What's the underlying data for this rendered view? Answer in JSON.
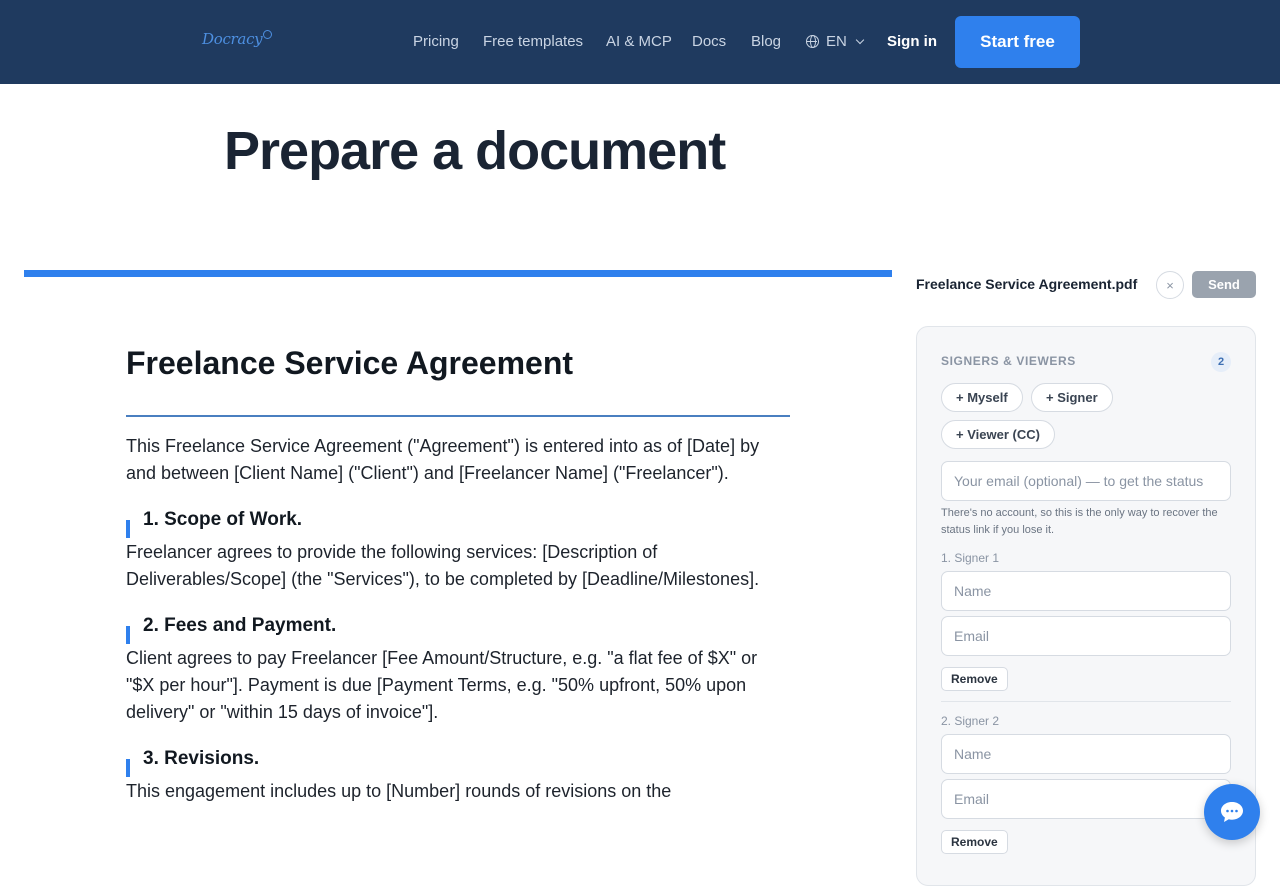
{
  "header": {
    "logo_text": "Docracy",
    "nav": [
      "Pricing",
      "Free templates",
      "AI & MCP",
      "Docs",
      "Blog"
    ],
    "language": "EN",
    "sign_in": "Sign in",
    "start_free": "Start free"
  },
  "page": {
    "title": "Prepare a document"
  },
  "document": {
    "title": "Freelance Service Agreement",
    "intro": "This Freelance Service Agreement (\"Agreement\") is entered into as of [Date] by and between [Client Name] (\"Client\") and [Freelancer Name] (\"Freelancer\").",
    "sections": [
      {
        "heading": "1. Scope of Work.",
        "body": "Freelancer agrees to provide the following services: [Description of Deliverables/Scope] (the \"Services\"), to be completed by [Deadline/Milestones]."
      },
      {
        "heading": "2. Fees and Payment.",
        "body": "Client agrees to pay Freelancer [Fee Amount/Structure, e.g. \"a flat fee of $X\" or \"$X per hour\"]. Payment is due [Payment Terms, e.g. \"50% upfront, 50% upon delivery\" or \"within 15 days of invoice\"]."
      },
      {
        "heading": "3. Revisions.",
        "body": "This engagement includes up to [Number] rounds of revisions on the"
      }
    ]
  },
  "panel": {
    "file_name": "Freelance Service Agreement.pdf",
    "close_symbol": "×",
    "send": "Send",
    "heading": "SIGNERS & VIEWERS",
    "count": "2",
    "add_buttons": [
      "+ Myself",
      "+ Signer",
      "+ Viewer (CC)"
    ],
    "email_placeholder": "Your email (optional) — to get the status",
    "hint": "There's no account, so this is the only way to recover the status link if you lose it.",
    "signers": [
      {
        "label": "1. Signer 1",
        "name_placeholder": "Name",
        "email_placeholder": "Email",
        "remove": "Remove"
      },
      {
        "label": "2. Signer 2",
        "name_placeholder": "Name",
        "email_placeholder": "Email",
        "remove": "Remove"
      }
    ]
  },
  "icons": {
    "globe": "globe-icon",
    "chevron": "chevron-down-icon",
    "chat": "chat-bubble-icon"
  },
  "colors": {
    "header_bg": "#1f3a5f",
    "accent": "#2f80ed",
    "send_disabled": "#9aa3ae"
  }
}
